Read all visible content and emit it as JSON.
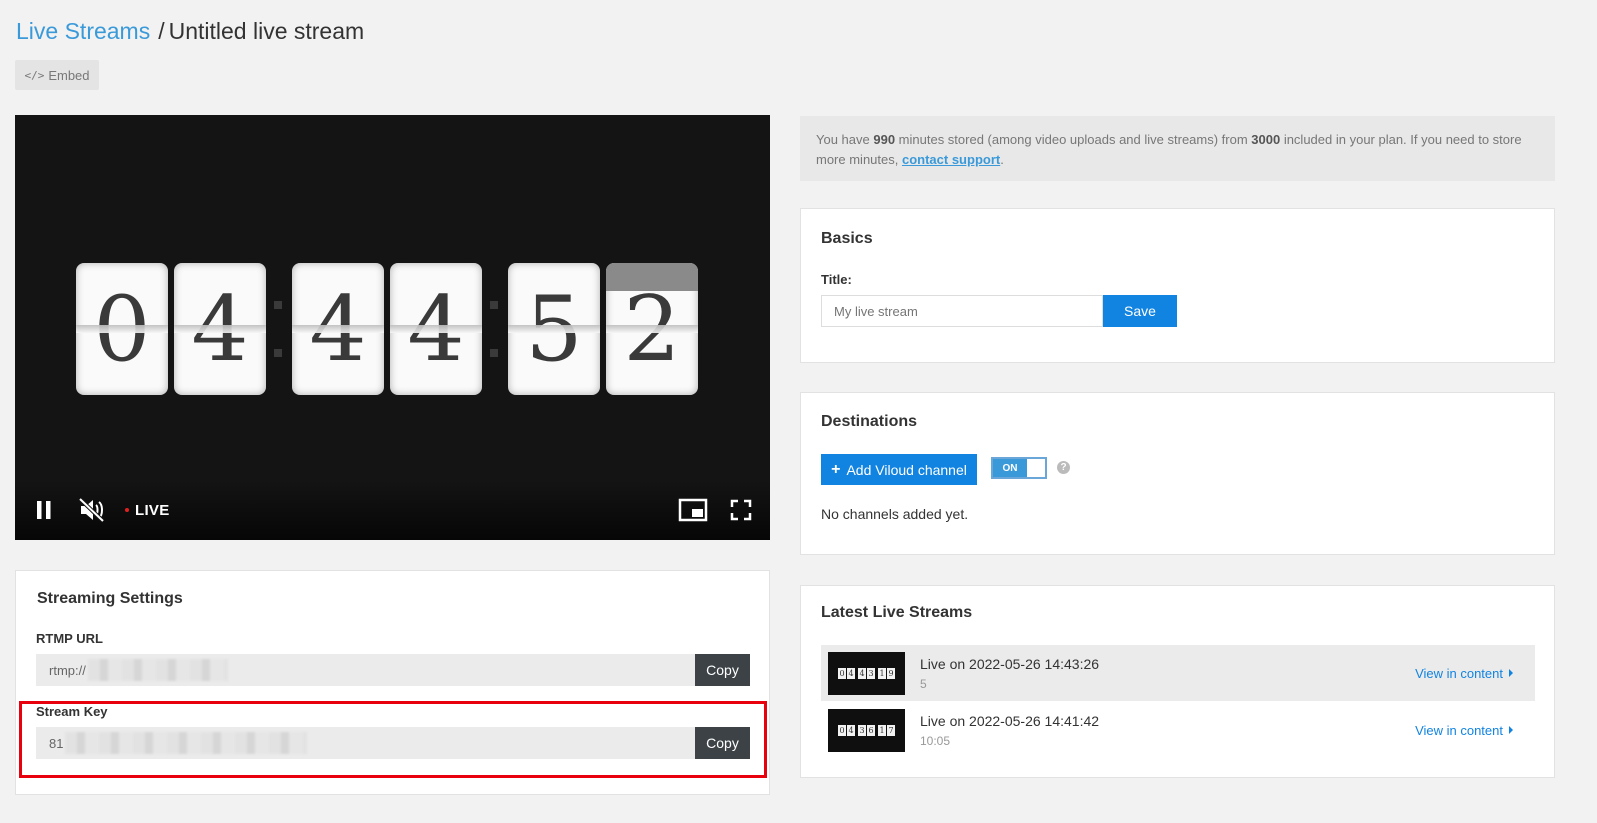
{
  "breadcrumb": {
    "parent": "Live Streams",
    "separator": "/",
    "current": "Untitled live stream"
  },
  "embed": {
    "icon": "code-icon",
    "glyph": "</>",
    "label": "Embed"
  },
  "player": {
    "digits": [
      "0",
      "4",
      "4",
      "4",
      "5",
      "2"
    ],
    "live_label": "LIVE",
    "controls": [
      "pause-icon",
      "mute-icon",
      "picture-in-picture-icon",
      "fullscreen-icon"
    ]
  },
  "settings": {
    "title": "Streaming Settings",
    "rtmp_label": "RTMP URL",
    "rtmp_value": "rtmp://",
    "key_label": "Stream Key",
    "key_value": "81",
    "copy_label": "Copy"
  },
  "info": {
    "p1": "You have ",
    "stored_minutes": "990",
    "p2": " minutes stored (among video uploads and live streams) from ",
    "included_minutes": "3000",
    "p3": " included in your plan. If you need to store more minutes, ",
    "link": "contact support",
    "p4": "."
  },
  "basics": {
    "title": "Basics",
    "title_label": "Title:",
    "placeholder": "My live stream",
    "save_label": "Save"
  },
  "destinations": {
    "title": "Destinations",
    "add_label": "Add Viloud channel",
    "toggle_label": "ON",
    "help_glyph": "?",
    "empty": "No channels added yet."
  },
  "latest": {
    "title": "Latest Live Streams",
    "view_label": "View in content",
    "items": [
      {
        "title": "Live on 2022-05-26 14:43:26",
        "subtitle": "5",
        "thumb": [
          "0",
          "4",
          "4",
          "3",
          "1",
          "9"
        ]
      },
      {
        "title": "Live on 2022-05-26 14:41:42",
        "subtitle": "10:05",
        "thumb": [
          "0",
          "4",
          "3",
          "6",
          "1",
          "7"
        ]
      }
    ]
  },
  "colors": {
    "accent": "#1184e2",
    "link": "#3a9ad9",
    "highlight": "#e8000c",
    "player_bg": "#141414"
  }
}
